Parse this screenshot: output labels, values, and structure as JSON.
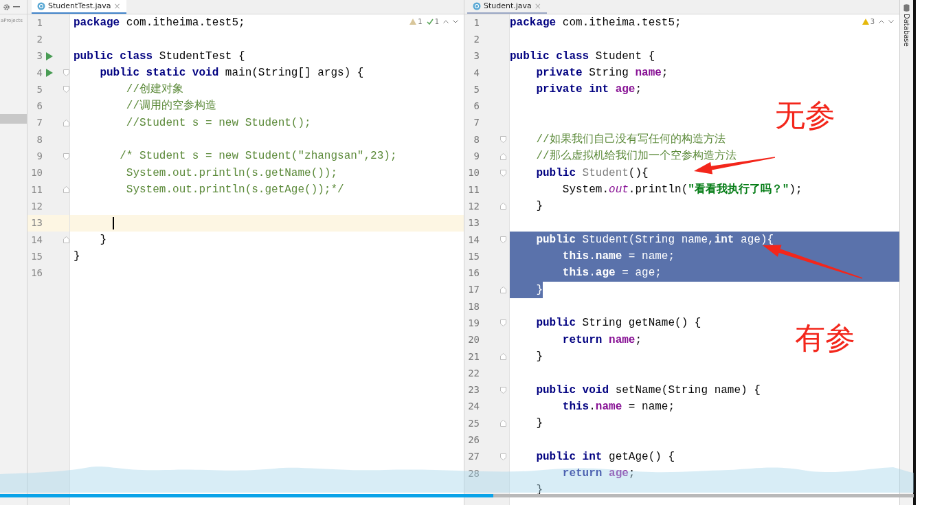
{
  "project_pane": {
    "label": "aProjects"
  },
  "left_editor": {
    "tab": {
      "label": "StudentTest.java",
      "selected": true,
      "close": "×"
    },
    "warnings": "1",
    "checks": "1",
    "lines": [
      {
        "n": "1",
        "tokens": [
          {
            "kind": "kw",
            "text": "package"
          },
          {
            "kind": "plain",
            "text": " com.itheima.test5;"
          }
        ]
      },
      {
        "n": "2"
      },
      {
        "n": "3",
        "run": true,
        "tokens": [
          {
            "kind": "kw",
            "text": "public class"
          },
          {
            "kind": "plain",
            "text": " StudentTest {"
          }
        ]
      },
      {
        "n": "4",
        "run": true,
        "fold_top": true,
        "tokens": [
          {
            "kind": "kw",
            "text": "    public static void"
          },
          {
            "kind": "plain",
            "text": " main(String[] args) {"
          }
        ]
      },
      {
        "n": "5",
        "fold_top": true,
        "tokens": [
          {
            "kind": "comment",
            "text": "        //创建对象"
          }
        ]
      },
      {
        "n": "6",
        "tokens": [
          {
            "kind": "comment",
            "text": "        //调用的空参构造"
          }
        ]
      },
      {
        "n": "7",
        "fold_bottom": true,
        "tokens": [
          {
            "kind": "comment",
            "text": "        //Student s = new Student();"
          }
        ]
      },
      {
        "n": "8"
      },
      {
        "n": "9",
        "fold_top": true,
        "tokens": [
          {
            "kind": "comment",
            "text": "       /* Student s = new Student(\"zhangsan\",23);"
          }
        ]
      },
      {
        "n": "10",
        "tokens": [
          {
            "kind": "comment",
            "text": "        System.out.println(s.getName());"
          }
        ]
      },
      {
        "n": "11",
        "fold_bottom": true,
        "tokens": [
          {
            "kind": "comment",
            "text": "        System.out.println(s.getAge());*/"
          }
        ]
      },
      {
        "n": "12"
      },
      {
        "n": "13",
        "caret": true
      },
      {
        "n": "14",
        "fold_bottom": true,
        "tokens": [
          {
            "kind": "plain",
            "text": "    }"
          }
        ]
      },
      {
        "n": "15",
        "tokens": [
          {
            "kind": "plain",
            "text": "}"
          }
        ]
      },
      {
        "n": "16"
      }
    ]
  },
  "right_editor": {
    "tab": {
      "label": "Student.java",
      "selected": false,
      "close": "×"
    },
    "warnings": "3",
    "lines": [
      {
        "n": "1",
        "selected": false,
        "tokens": [
          {
            "kind": "kw",
            "text": "package"
          },
          {
            "kind": "plain",
            "text": " com.itheima.test5;"
          }
        ]
      },
      {
        "n": "2",
        "selected": false
      },
      {
        "n": "3",
        "selected": false,
        "tokens": [
          {
            "kind": "kw",
            "text": "public class"
          },
          {
            "kind": "plain",
            "text": " Student {"
          }
        ]
      },
      {
        "n": "4",
        "selected": false,
        "tokens": [
          {
            "kind": "kw",
            "text": "    private"
          },
          {
            "kind": "plain",
            "text": " String "
          },
          {
            "kind": "field",
            "text": "name"
          },
          {
            "kind": "plain",
            "text": ";"
          }
        ]
      },
      {
        "n": "5",
        "selected": false,
        "tokens": [
          {
            "kind": "kw",
            "text": "    private int"
          },
          {
            "kind": "field",
            "text": " age"
          },
          {
            "kind": "plain",
            "text": ";"
          }
        ]
      },
      {
        "n": "6",
        "selected": false
      },
      {
        "n": "7",
        "selected": false
      },
      {
        "n": "8",
        "fold_top": true,
        "selected": false,
        "tokens": [
          {
            "kind": "comment",
            "text": "    //如果我们自己没有写任何的构造方法"
          }
        ]
      },
      {
        "n": "9",
        "fold_bottom": true,
        "selected": false,
        "tokens": [
          {
            "kind": "comment",
            "text": "    //那么虚拟机给我们加一个空参构造方法"
          }
        ]
      },
      {
        "n": "10",
        "fold_top": true,
        "selected": false,
        "tokens": [
          {
            "kind": "kw",
            "text": "    public"
          },
          {
            "kind": "unused",
            "text": " Student"
          },
          {
            "kind": "plain",
            "text": "(){"
          }
        ]
      },
      {
        "n": "11",
        "selected": false,
        "tokens": [
          {
            "kind": "plain",
            "text": "        System."
          },
          {
            "kind": "static",
            "text": "out"
          },
          {
            "kind": "plain",
            "text": ".println("
          },
          {
            "kind": "string",
            "text": "\"看看我执行了吗？\""
          },
          {
            "kind": "plain",
            "text": ");"
          }
        ]
      },
      {
        "n": "12",
        "fold_bottom": true,
        "selected": false,
        "tokens": [
          {
            "kind": "plain",
            "text": "    }"
          }
        ]
      },
      {
        "n": "13",
        "selected": false
      },
      {
        "n": "14",
        "fold_top": true,
        "selected": true,
        "tokens": [
          {
            "kind": "kw",
            "text": "    public"
          },
          {
            "kind": "plain",
            "text": " Student(String name,"
          },
          {
            "kind": "kw",
            "text": "int"
          },
          {
            "kind": "plain",
            "text": " age){"
          }
        ]
      },
      {
        "n": "15",
        "selected": true,
        "tokens": [
          {
            "kind": "kw",
            "text": "        this"
          },
          {
            "kind": "plain",
            "text": "."
          },
          {
            "kind": "field",
            "text": "name"
          },
          {
            "kind": "plain",
            "text": " = name;"
          }
        ]
      },
      {
        "n": "16",
        "selected": true,
        "tokens": [
          {
            "kind": "kw",
            "text": "        this"
          },
          {
            "kind": "plain",
            "text": "."
          },
          {
            "kind": "field",
            "text": "age"
          },
          {
            "kind": "plain",
            "text": " = age;"
          }
        ]
      },
      {
        "n": "17",
        "fold_bottom": true,
        "selected": true,
        "tokens": [
          {
            "kind": "plain",
            "text": "    }"
          }
        ]
      },
      {
        "n": "18",
        "selected": false
      },
      {
        "n": "19",
        "fold_top": true,
        "selected": false,
        "tokens": [
          {
            "kind": "kw",
            "text": "    public"
          },
          {
            "kind": "plain",
            "text": " String getName() {"
          }
        ]
      },
      {
        "n": "20",
        "selected": false,
        "tokens": [
          {
            "kind": "kw",
            "text": "        return"
          },
          {
            "kind": "field",
            "text": " name"
          },
          {
            "kind": "plain",
            "text": ";"
          }
        ]
      },
      {
        "n": "21",
        "fold_bottom": true,
        "selected": false,
        "tokens": [
          {
            "kind": "plain",
            "text": "    }"
          }
        ]
      },
      {
        "n": "22",
        "selected": false
      },
      {
        "n": "23",
        "fold_top": true,
        "selected": false,
        "tokens": [
          {
            "kind": "kw",
            "text": "    public void"
          },
          {
            "kind": "plain",
            "text": " setName(String name) {"
          }
        ]
      },
      {
        "n": "24",
        "selected": false,
        "tokens": [
          {
            "kind": "kw",
            "text": "        this"
          },
          {
            "kind": "plain",
            "text": "."
          },
          {
            "kind": "field",
            "text": "name"
          },
          {
            "kind": "plain",
            "text": " = name;"
          }
        ]
      },
      {
        "n": "25",
        "fold_bottom": true,
        "selected": false,
        "tokens": [
          {
            "kind": "plain",
            "text": "    }"
          }
        ]
      },
      {
        "n": "26",
        "selected": false
      },
      {
        "n": "27",
        "fold_top": true,
        "selected": false,
        "tokens": [
          {
            "kind": "kw",
            "text": "    public int"
          },
          {
            "kind": "plain",
            "text": " getAge() {"
          }
        ]
      },
      {
        "n": "28",
        "selected": false,
        "tokens": [
          {
            "kind": "kw",
            "text": "        return"
          },
          {
            "kind": "field",
            "text": " age"
          },
          {
            "kind": "plain",
            "text": ";"
          }
        ]
      },
      {
        "selected": false,
        "tokens": [
          {
            "kind": "plain",
            "text": "    }"
          }
        ]
      }
    ]
  },
  "side_toolbar": {
    "label": "Database"
  },
  "annotations": [
    {
      "text": "无参"
    },
    {
      "text": "有参"
    }
  ],
  "video_player": {
    "level": 0.54
  }
}
